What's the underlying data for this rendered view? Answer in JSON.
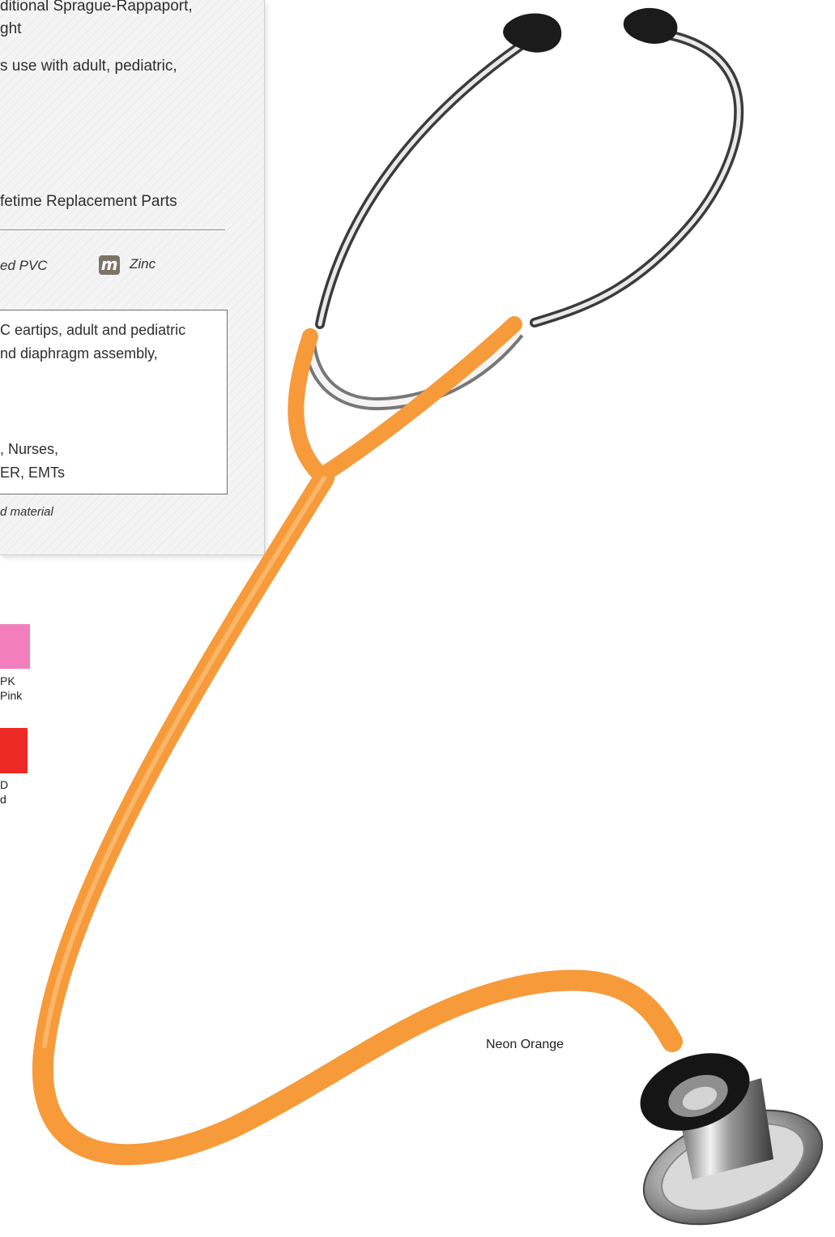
{
  "spec_panel": {
    "lines": [
      "ditional Sprague-Rappaport,",
      "ght",
      "s use with adult, pediatric,",
      "fetime Replacement Parts"
    ],
    "materials": [
      {
        "label": "ed PVC"
      },
      {
        "icon": "m",
        "label": "Zinc"
      }
    ],
    "box_lines": [
      "C eartips, adult and pediatric",
      "nd diaphragm assembly,",
      ", Nurses,",
      "ER, EMTs"
    ],
    "footnote": "d material"
  },
  "swatches": [
    {
      "code": "PK",
      "name": "Pink",
      "color": "#f27fbb"
    },
    {
      "code": "D",
      "name": "d",
      "color": "#ee2a24"
    }
  ],
  "product": {
    "color_name": "Neon Orange",
    "tube_color": "#f79a3a",
    "eartip_color": "#1b1b1b"
  }
}
